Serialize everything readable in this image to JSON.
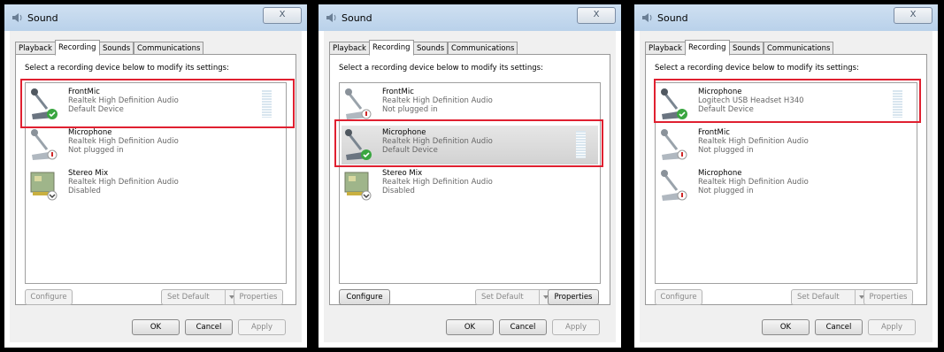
{
  "panels": [
    {
      "title": "Sound",
      "close_label": "X",
      "tabs": [
        "Playback",
        "Recording",
        "Sounds",
        "Communications"
      ],
      "active_tab": 1,
      "instruction": "Select a recording device below to modify its settings:",
      "devices": [
        {
          "name": "FrontMic",
          "driver": "Realtek High Definition Audio",
          "status": "Default Device",
          "icon": "microphone-icon",
          "badge": "default-check"
        },
        {
          "name": "Microphone",
          "driver": "Realtek High Definition Audio",
          "status": "Not plugged in",
          "icon": "microphone-icon",
          "badge": "unplugged"
        },
        {
          "name": "Stereo Mix",
          "driver": "Realtek High Definition Audio",
          "status": "Disabled",
          "icon": "sound-card-icon",
          "badge": "disabled"
        }
      ],
      "buttons": {
        "configure": "Configure",
        "set_default": "Set Default",
        "properties": "Properties",
        "ok": "OK",
        "cancel": "Cancel",
        "apply": "Apply"
      }
    },
    {
      "title": "Sound",
      "close_label": "X",
      "tabs": [
        "Playback",
        "Recording",
        "Sounds",
        "Communications"
      ],
      "active_tab": 1,
      "instruction": "Select a recording device below to modify its settings:",
      "devices": [
        {
          "name": "FrontMic",
          "driver": "Realtek High Definition Audio",
          "status": "Not plugged in",
          "icon": "microphone-icon",
          "badge": "unplugged"
        },
        {
          "name": "Microphone",
          "driver": "Realtek High Definition Audio",
          "status": "Default Device",
          "icon": "microphone-icon",
          "badge": "default-check"
        },
        {
          "name": "Stereo Mix",
          "driver": "Realtek High Definition Audio",
          "status": "Disabled",
          "icon": "sound-card-icon",
          "badge": "disabled"
        }
      ],
      "buttons": {
        "configure": "Configure",
        "set_default": "Set Default",
        "properties": "Properties",
        "ok": "OK",
        "cancel": "Cancel",
        "apply": "Apply"
      }
    },
    {
      "title": "Sound",
      "close_label": "X",
      "tabs": [
        "Playback",
        "Recording",
        "Sounds",
        "Communications"
      ],
      "active_tab": 1,
      "instruction": "Select a recording device below to modify its settings:",
      "devices": [
        {
          "name": "Microphone",
          "driver": "Logitech USB Headset H340",
          "status": "Default Device",
          "icon": "microphone-icon",
          "badge": "default-check"
        },
        {
          "name": "FrontMic",
          "driver": "Realtek High Definition Audio",
          "status": "Not plugged in",
          "icon": "microphone-icon",
          "badge": "unplugged"
        },
        {
          "name": "Microphone",
          "driver": "Realtek High Definition Audio",
          "status": "Not plugged in",
          "icon": "microphone-icon",
          "badge": "unplugged"
        }
      ],
      "buttons": {
        "configure": "Configure",
        "set_default": "Set Default",
        "properties": "Properties",
        "ok": "OK",
        "cancel": "Cancel",
        "apply": "Apply"
      }
    }
  ],
  "colors": {
    "highlight": "#e02030",
    "check_green": "#3aa640",
    "unplugged_red": "#d02828"
  }
}
